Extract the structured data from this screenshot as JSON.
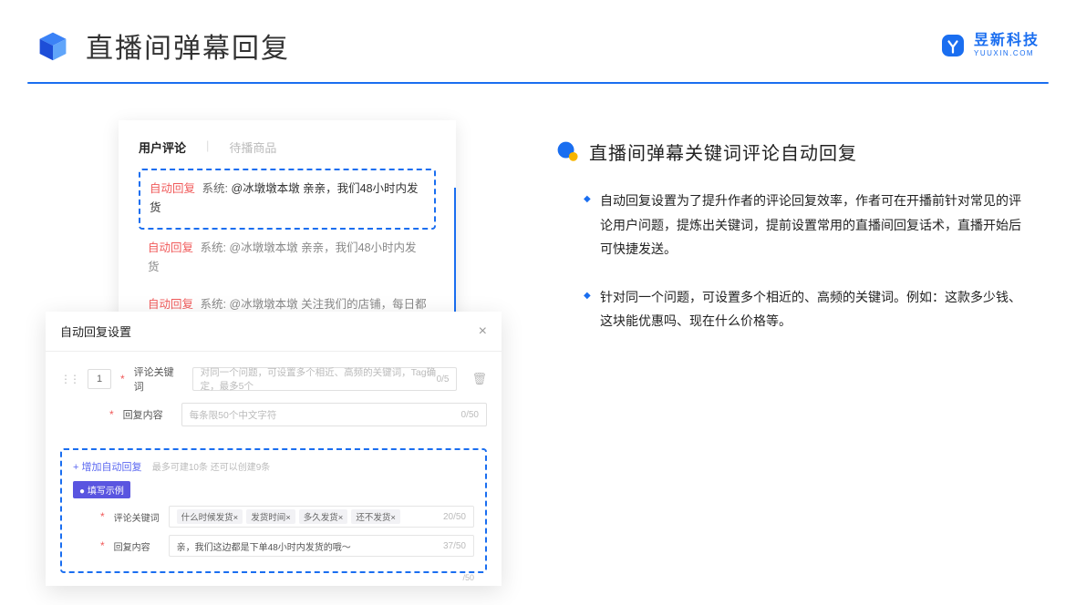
{
  "header": {
    "title": "直播间弹幕回复",
    "brand_cn": "昱新科技",
    "brand_en": "YUUXIN.COM"
  },
  "section": {
    "title": "直播间弹幕关键词评论自动回复",
    "bullets": [
      "自动回复设置为了提升作者的评论回复效率，作者可在开播前针对常见的评论用户问题，提炼出关键词，提前设置常用的直播间回复话术，直播开始后可快捷发送。",
      "针对同一个问题，可设置多个相近的、高频的关键词。例如：这款多少钱、这块能优惠吗、现在什么价格等。"
    ]
  },
  "comments": {
    "tab_active": "用户评论",
    "tab_inactive": "待播商品",
    "rows": [
      {
        "tag": "自动回复",
        "sys": "系统:",
        "body": "@冰墩墩本墩 亲亲，我们48小时内发货"
      },
      {
        "tag": "自动回复",
        "sys": "系统:",
        "body": "@冰墩墩本墩 亲亲，我们48小时内发货"
      },
      {
        "tag": "自动回复",
        "sys": "系统:",
        "body": "@冰墩墩本墩 关注我们的店铺，每日都有热门推荐呦～"
      }
    ]
  },
  "settings": {
    "title": "自动回复设置",
    "order": "1",
    "label_keyword": "评论关键词",
    "placeholder_keyword": "对同一个问题，可设置多个相近、高频的关键词，Tag确定，最多5个",
    "counter_keyword": "0/5",
    "label_reply": "回复内容",
    "placeholder_reply": "每条限50个中文字符",
    "counter_reply": "0/50",
    "add_link": "+ 增加自动回复",
    "add_hint": "最多可建10条 还可以创建9条",
    "badge": "● 填写示例",
    "ex_label_keyword": "评论关键词",
    "chips": [
      "什么时候发货×",
      "发货时间×",
      "多久发货×",
      "还不发货×"
    ],
    "ex_counter_keyword": "20/50",
    "ex_label_reply": "回复内容",
    "ex_reply_value": "亲，我们这边都是下单48小时内发货的哦～",
    "ex_counter_reply": "37/50",
    "bottom_counter": "/50"
  }
}
